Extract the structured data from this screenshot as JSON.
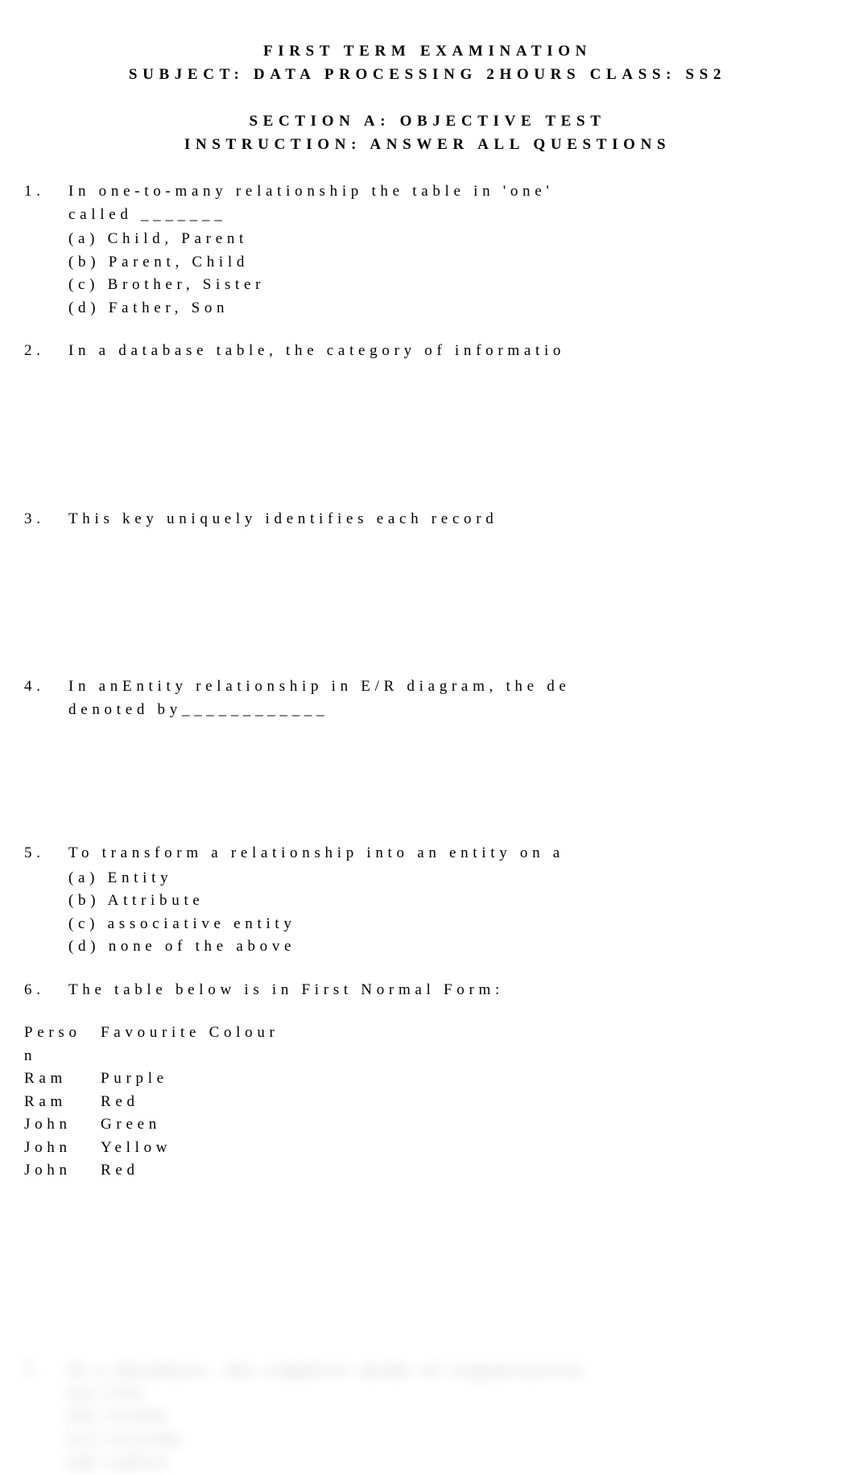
{
  "header": {
    "line1": "FIRST TERM EXAMINATION",
    "line2": "SUBJECT: DATA PROCESSING 2HOURS CLASS: SS2"
  },
  "section": {
    "title": "SECTION A: OBJECTIVE TEST",
    "instruction": "INSTRUCTION: ANSWER ALL QUESTIONS"
  },
  "questions": [
    {
      "num": "1.",
      "text": "In one-to-many relationship the table in 'one'",
      "blank": "called _______",
      "options": {
        "a": "(a) Child, Parent",
        "b": "(b) Parent, Child",
        "c": "(c) Brother, Sister",
        "d": "(d) Father, Son"
      }
    },
    {
      "num": "2.",
      "text": "In a database table, the category of informatio"
    },
    {
      "num": "3.",
      "text": "This key uniquely identifies each record"
    },
    {
      "num": "4.",
      "text": "In anEntity relationship in E/R diagram, the de",
      "line2": "denoted by____________"
    },
    {
      "num": "5.",
      "text": "To transform a relationship into an entity on a",
      "options": {
        "a": "(a) Entity",
        "b": "(b) Attribute",
        "c": "(c) associative entity",
        "d": "(d) none of the above"
      }
    },
    {
      "num": "6.",
      "text": "The table below is in First Normal Form:"
    }
  ],
  "table": {
    "header": {
      "col1": "Person",
      "col2": "Favourite Colour"
    },
    "header_display": {
      "col1a": "Perso",
      "col1b": "n",
      "col2": "Favourite Colour"
    },
    "rows": [
      {
        "col1": "Ram",
        "col2": "Purple"
      },
      {
        "col1": "Ram",
        "col2": "Red"
      },
      {
        "col1": "John",
        "col2": "Green"
      },
      {
        "col1": "John",
        "col2": "Yellow"
      },
      {
        "col1": "John",
        "col2": "Red"
      }
    ]
  },
  "blurred": {
    "num": "7.",
    "text": "In a database, the simplest mode of organization",
    "opts": {
      "a": "(a) file",
      "b": "(b) fields",
      "c": "(c) records",
      "d": "(d) tables"
    }
  }
}
